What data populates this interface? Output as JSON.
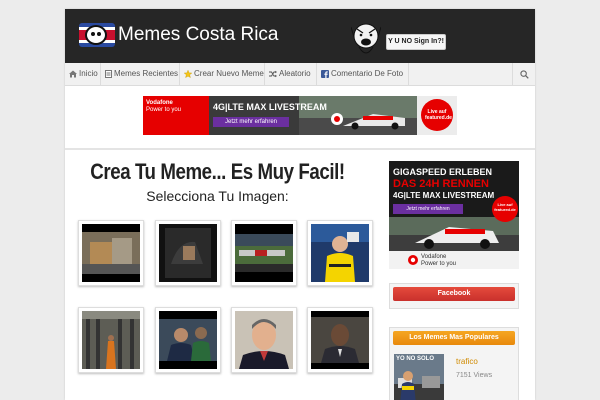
{
  "header": {
    "site_title": "Memes Costa Rica",
    "yuno_button": "Y U NO Sign In?!"
  },
  "nav": {
    "items": [
      {
        "label": "Inicio",
        "icon": "home-icon"
      },
      {
        "label": "Memes Recientes",
        "icon": "document-icon"
      },
      {
        "label": "Crear Nuevo Meme",
        "icon": "star-icon"
      },
      {
        "label": "Aleatorio",
        "icon": "shuffle-icon"
      },
      {
        "label": "Comentario De Foto",
        "icon": "facebook-icon"
      }
    ],
    "search_icon": "search-icon"
  },
  "ads": {
    "banner": {
      "brand": "Vodafone",
      "brand_tag": "Power to you",
      "headline": "4G|LTE MAX LIVESTREAM",
      "cta": "Jetzt mehr erfahren",
      "badge": "Live auf featured.de"
    },
    "side": {
      "line1": "GIGASPEED ERLEBEN",
      "line2": "DAS 24H RENNEN",
      "line3": "4G|LTE MAX LIVESTREAM",
      "cta": "Jetzt mehr erfahren",
      "badge": "Live auf featured.de",
      "brand": "Vodafone",
      "brand_tag": "Power to you"
    }
  },
  "main": {
    "title": "Crea Tu Meme... Es Muy Facil!",
    "subtitle": "Selecciona Tu Imagen:"
  },
  "sidebar": {
    "facebook_label": "Facebook",
    "popular": {
      "header": "Los Memes Mas Populares",
      "items": [
        {
          "title": "trafico",
          "views": "7151 Views",
          "caption": "YO NO SOLO"
        }
      ]
    }
  },
  "colors": {
    "header_bg": "#262626",
    "facebook_btn": "#d9362b",
    "popular_hdr": "#f0961a",
    "popular_link": "#d08a00"
  }
}
